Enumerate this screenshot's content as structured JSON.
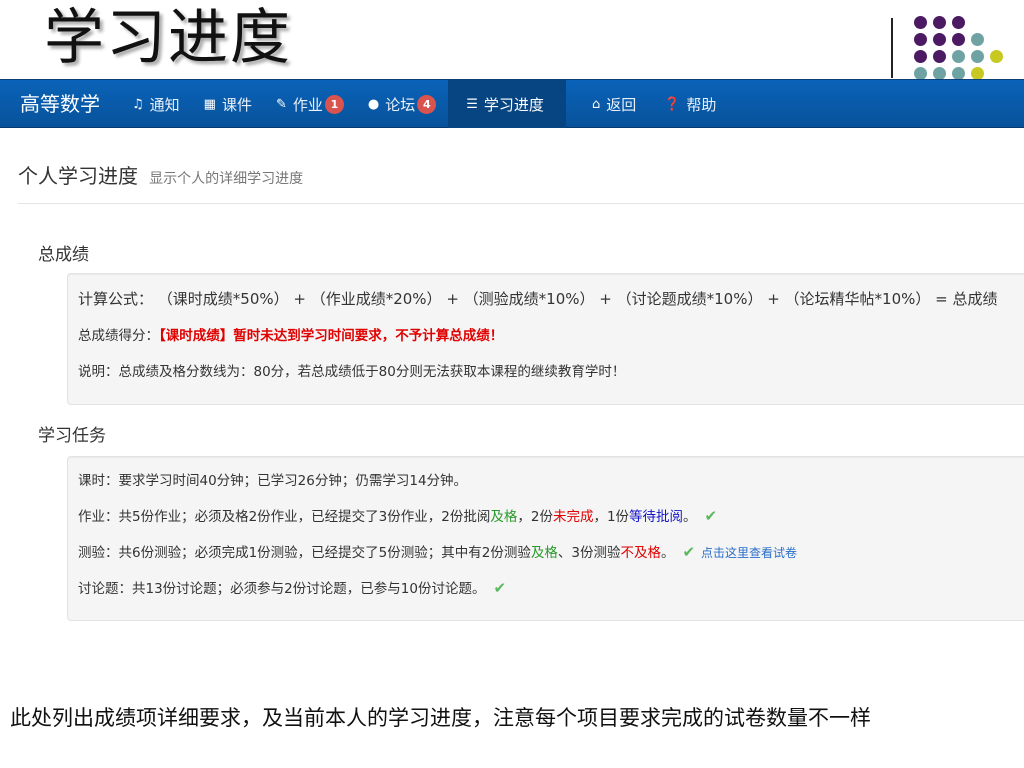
{
  "slide": {
    "title": "学习进度",
    "caption": "此处列出成绩项详细要求，及当前本人的学习进度，注意每个项目要求完成的试卷数量不一样",
    "dot_colors": [
      "#4b1a63",
      "#6fa3a3",
      "#c8c822"
    ]
  },
  "navbar": {
    "brand": "高等数学",
    "items": [
      {
        "icon": "bell-icon",
        "glyph": "♫",
        "label": "通知"
      },
      {
        "icon": "film-icon",
        "glyph": "▦",
        "label": "课件"
      },
      {
        "icon": "pencil-icon",
        "glyph": "✎",
        "label": "作业",
        "badge": "1"
      },
      {
        "icon": "comment-icon",
        "glyph": "●",
        "label": "论坛",
        "badge": "4"
      },
      {
        "icon": "list-icon",
        "glyph": "☰",
        "label": "学习进度",
        "active": true
      },
      {
        "icon": "home-icon",
        "glyph": "⌂",
        "label": "返回"
      },
      {
        "icon": "question-icon",
        "glyph": "❓",
        "label": "帮助"
      }
    ],
    "colors": {
      "bar": "#0a5aa8",
      "active": "#074582",
      "badge": "#d9534f"
    }
  },
  "header": {
    "title": "个人学习进度",
    "subtitle": "显示个人的详细学习进度"
  },
  "total": {
    "heading": "总成绩",
    "formula": "计算公式：  （课时成绩*50%） + （作业成绩*20%） + （测验成绩*10%） + （讨论题成绩*10%） + （论坛精华帖*10%） = 总成绩",
    "score_label": "总成绩得分：",
    "score_value": "【课时成绩】暂时未达到学习时间要求，不予计算总成绩！",
    "note": "说明：总成绩及格分数线为：80分，若总成绩低于80分则无法获取本课程的继续教育学时！"
  },
  "tasks": {
    "heading": "学习任务",
    "lesson": "课时：要求学习时间40分钟；已学习26分钟；仍需学习14分钟。",
    "homework": {
      "prefix": "作业：共5份作业；必须及格2份作业，已经提交了3份作业，2份批阅",
      "pass": "及格",
      "mid": "，2份",
      "unfinished": "未完成",
      "mid2": "，1份",
      "pending": "等待批阅",
      "end": "。"
    },
    "quiz": {
      "prefix": "测验：共6份测验；必须完成1份测验，已经提交了5份测验；其中有2份测验",
      "pass": "及格",
      "mid": "、3份测验",
      "fail": "不及格",
      "end": "。",
      "link": "点击这里查看试卷"
    },
    "discussion": "讨论题：共13份讨论题；必须参与2份讨论题，已参与10份讨论题。"
  }
}
